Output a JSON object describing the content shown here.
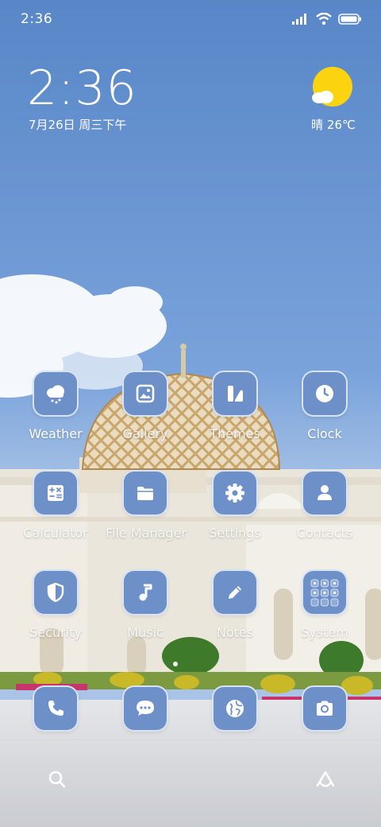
{
  "status_bar": {
    "time": "2:36"
  },
  "clock_widget": {
    "time": "2:36",
    "date": "7月26日 周三下午"
  },
  "weather_widget": {
    "text": "晴 26℃",
    "icon": "sunny-cloud-icon",
    "sun_color": "#fcd30f"
  },
  "apps": {
    "weather": {
      "label": "Weather",
      "icon": "cloud-rain-icon"
    },
    "gallery": {
      "label": "Gallery",
      "icon": "image-icon"
    },
    "themes": {
      "label": "Themes",
      "icon": "themes-icon"
    },
    "clock": {
      "label": "Clock",
      "icon": "clock-icon"
    },
    "calculator": {
      "label": "Calculator",
      "icon": "calculator-icon"
    },
    "file_manager": {
      "label": "File Manager",
      "icon": "folder-icon"
    },
    "settings": {
      "label": "Settings",
      "icon": "gear-icon"
    },
    "contacts": {
      "label": "Contacts",
      "icon": "person-icon"
    },
    "security": {
      "label": "Security",
      "icon": "shield-icon"
    },
    "music": {
      "label": "Music",
      "icon": "music-note-icon"
    },
    "notes": {
      "label": "Notes",
      "icon": "pencil-icon"
    },
    "system": {
      "label": "System",
      "icon": "folder-grid-icon"
    }
  },
  "dock": [
    {
      "name": "phone",
      "icon": "phone-icon"
    },
    {
      "name": "messaging",
      "icon": "chat-icon"
    },
    {
      "name": "browser",
      "icon": "globe-icon"
    },
    {
      "name": "camera",
      "icon": "camera-icon"
    }
  ],
  "bottom_bar": {
    "left_icon": "search-icon",
    "right_icon": "assistant-icon"
  },
  "colors": {
    "tile_bg": "#6d90c9",
    "tile_border": "#dee8f8",
    "sky": "#5b88c8"
  }
}
